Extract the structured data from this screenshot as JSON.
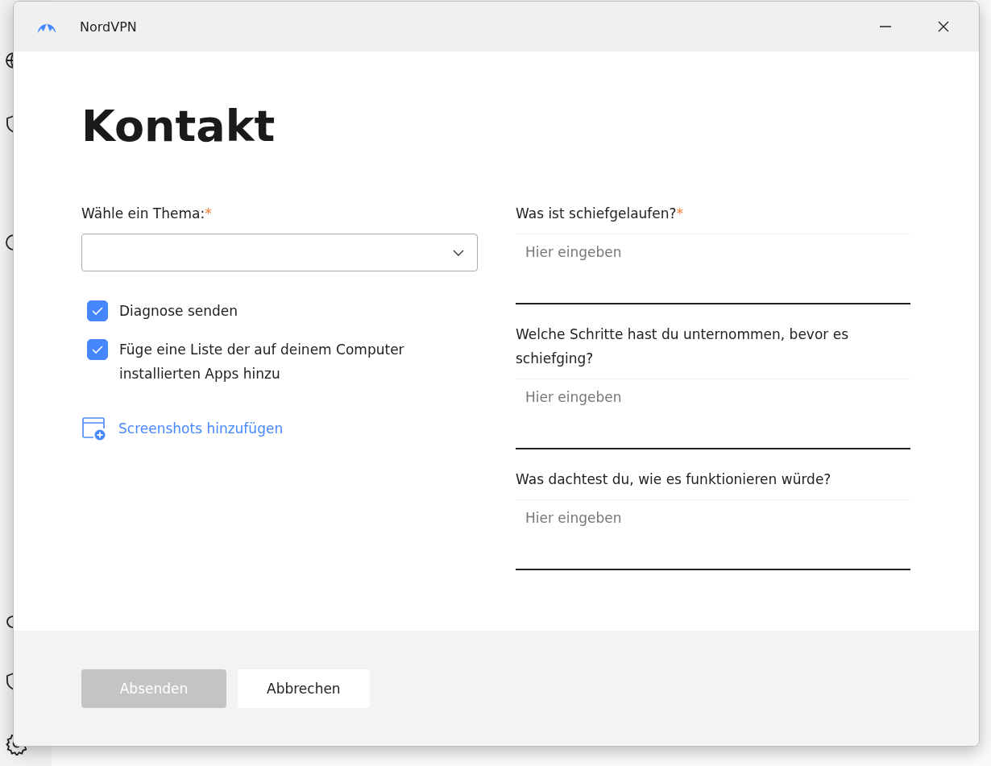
{
  "window": {
    "title": "NordVPN"
  },
  "heading": "Kontakt",
  "topic": {
    "label": "Wähle ein Thema:",
    "required_mark": "*"
  },
  "checkboxes": [
    {
      "label": "Diagnose senden",
      "checked": true
    },
    {
      "label": "Füge eine Liste der auf deinem Computer installierten Apps hinzu",
      "checked": true
    }
  ],
  "screenshot_link": "Screenshots hinzufügen",
  "questions": [
    {
      "label": "Was ist schiefgelaufen?",
      "required_mark": "*",
      "placeholder": "Hier eingeben"
    },
    {
      "label": "Welche Schritte hast du unternommen, bevor es schiefging?",
      "placeholder": "Hier eingeben"
    },
    {
      "label": "Was dachtest du, wie es funktionieren würde?",
      "placeholder": "Hier eingeben"
    }
  ],
  "buttons": [
    {
      "label": "Absenden",
      "disabled": true
    },
    {
      "label": "Abbrechen",
      "disabled": false
    }
  ]
}
